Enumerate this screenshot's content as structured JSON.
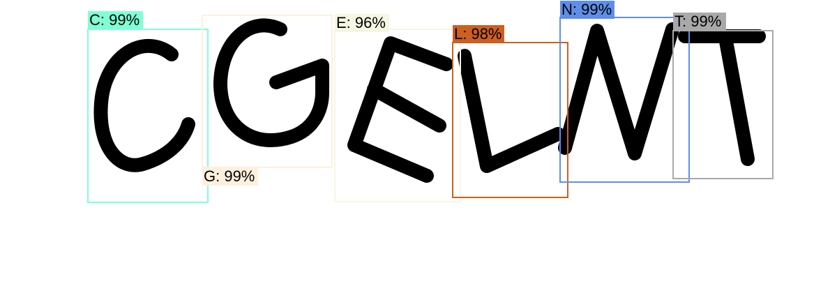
{
  "detections": [
    {
      "id": "c",
      "label": "C: 99%",
      "color": "#7fffd4"
    },
    {
      "id": "g",
      "label": "G: 99%",
      "color": "#fdf0dd"
    },
    {
      "id": "e",
      "label": "E: 96%",
      "color": "#f6f7e2"
    },
    {
      "id": "l",
      "label": "L: 98%",
      "color": "#cd5f1f"
    },
    {
      "id": "n",
      "label": "N: 99%",
      "color": "#5f8ee8"
    },
    {
      "id": "t",
      "label": "T: 99%",
      "color": "#a9a9a9"
    }
  ]
}
